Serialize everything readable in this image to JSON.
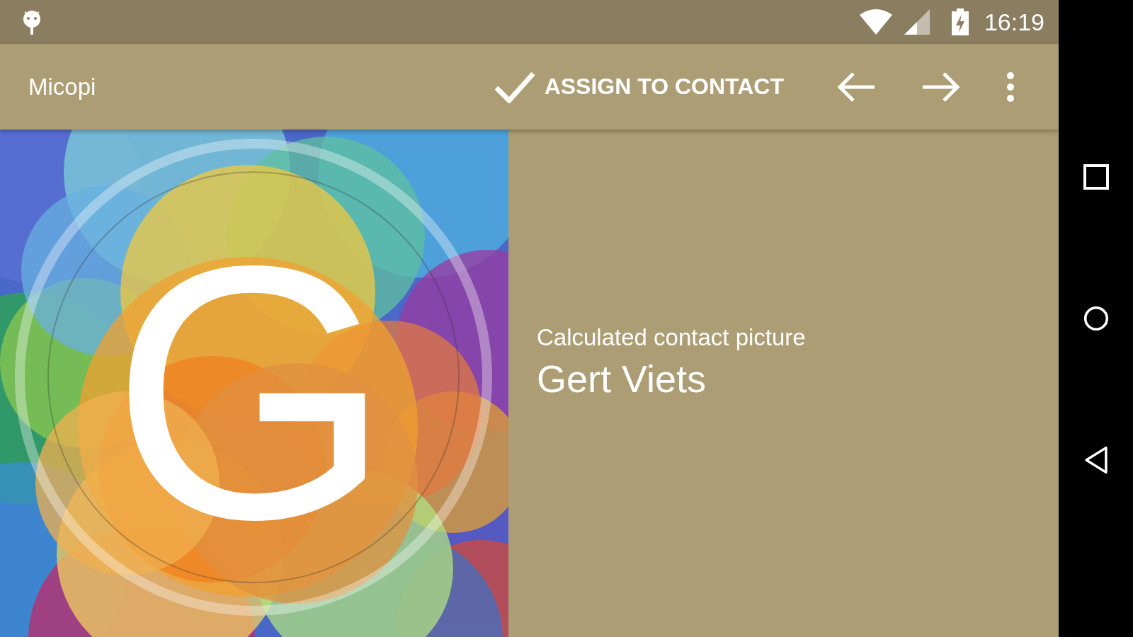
{
  "status_bar": {
    "time": "16:19"
  },
  "action_bar": {
    "title": "Micopi",
    "actions": [
      {
        "kind": "check",
        "label": "ASSIGN TO CONTACT"
      },
      {
        "kind": "back"
      },
      {
        "kind": "forward"
      },
      {
        "kind": "overflow"
      }
    ]
  },
  "picture": {
    "initial": "G"
  },
  "info": {
    "subtitle": "Calculated contact picture",
    "name": "Gert Viets"
  }
}
